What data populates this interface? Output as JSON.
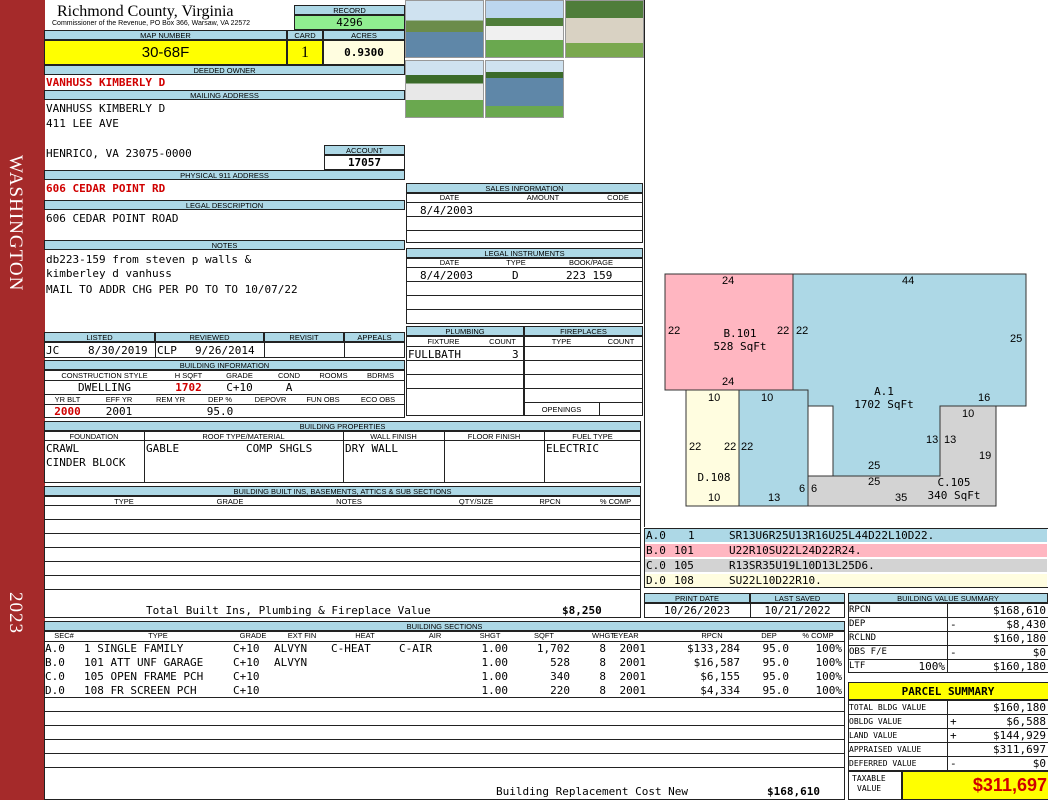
{
  "sidebar": {
    "district": "WASHINGTON",
    "year": "2023"
  },
  "header": {
    "county": "Richmond County, Virginia",
    "address_line": "Commissioner of the Revenue, PO Box 366, Warsaw, VA 22572",
    "record_label": "RECORD",
    "record": "4296",
    "map_number_label": "MAP NUMBER",
    "map_number": "30-68F",
    "card_label": "CARD",
    "card": "1",
    "acres_label": "ACRES",
    "acres": "0.9300"
  },
  "owner": {
    "deeded_owner_label": "DEEDED OWNER",
    "deeded_owner": "VANHUSS KIMBERLY D",
    "mailing_label": "MAILING ADDRESS",
    "mailing_line1": "VANHUSS KIMBERLY D",
    "mailing_line2": "411 LEE AVE",
    "mailing_line3": "HENRICO, VA 23075-0000",
    "account_label": "ACCOUNT",
    "account": "17057",
    "physical_label": "PHYSICAL 911 ADDRESS",
    "physical_address": "606 CEDAR POINT RD",
    "legal_label": "LEGAL DESCRIPTION",
    "legal_description": "606 CEDAR POINT ROAD",
    "notes_label": "NOTES",
    "notes_line1": "db223-159 from steven p walls &",
    "notes_line2": "kimberley d vanhuss",
    "notes_line3": "MAIL TO ADDR CHG PER PO TO TO 10/07/22"
  },
  "review": {
    "listed_label": "LISTED",
    "listed_by": "JC",
    "listed_date": "8/30/2019",
    "reviewed_label": "REVIEWED",
    "reviewed_by": "CLP",
    "reviewed_date": "9/26/2014",
    "revisit_label": "REVISIT",
    "appeals_label": "APPEALS"
  },
  "building_info": {
    "section_label": "BUILDING INFORMATION",
    "h_style": "CONSTRUCTION STYLE",
    "h_sqft": "H SQFT",
    "h_grade": "GRADE",
    "h_cond": "COND",
    "h_rooms": "ROOMS",
    "h_bdrms": "BDRMS",
    "style": "DWELLING",
    "sqft": "1702",
    "grade": "C+10",
    "cond": "A",
    "h_yrblt": "YR BLT",
    "h_effyr": "EFF YR",
    "h_remyr": "REM YR",
    "h_dep": "DEP %",
    "h_depovr": "DEPOVR",
    "h_funobs": "FUN OBS",
    "h_ecoobs": "ECO OBS",
    "yr_blt": "2000",
    "eff_yr": "2001",
    "dep": "95.0"
  },
  "sales": {
    "section_label": "SALES INFORMATION",
    "h_date": "DATE",
    "h_amount": "AMOUNT",
    "h_code": "CODE",
    "date": "8/4/2003"
  },
  "legal_instruments": {
    "section_label": "LEGAL INSTRUMENTS",
    "h_date": "DATE",
    "h_type": "TYPE",
    "h_bookpage": "BOOK/PAGE",
    "date": "8/4/2003",
    "type": "D",
    "bookpage": "223 159"
  },
  "plumbing": {
    "section_label": "PLUMBING",
    "h_fixture": "FIXTURE",
    "h_count": "COUNT",
    "fixture": "FULLBATH",
    "count": "3"
  },
  "fireplaces": {
    "section_label": "FIREPLACES",
    "h_type": "TYPE",
    "h_count": "COUNT",
    "openings_label": "OPENINGS"
  },
  "properties": {
    "section_label": "BUILDING PROPERTIES",
    "h_foundation": "FOUNDATION",
    "h_roof": "ROOF TYPE/MATERIAL",
    "h_wall": "WALL FINISH",
    "h_floor": "FLOOR FINISH",
    "h_fuel": "FUEL TYPE",
    "foundation1": "CRAWL",
    "foundation2": "CINDER BLOCK",
    "roof_type": "GABLE",
    "roof_material": "COMP SHGLS",
    "wall": "DRY WALL",
    "fuel": "ELECTRIC"
  },
  "builtins": {
    "section_label": "BUILDING BUILT INS, BASEMENTS, ATTICS & SUB SECTIONS",
    "h_type": "TYPE",
    "h_grade": "GRADE",
    "h_notes": "NOTES",
    "h_qty": "QTY/SIZE",
    "h_rpcn": "RPCN",
    "h_comp": "% COMP",
    "total_label": "Total Built Ins, Plumbing & Fireplace Value",
    "total_value": "$8,250"
  },
  "dates": {
    "print_label": "PRINT DATE",
    "print_date": "10/26/2023",
    "saved_label": "LAST SAVED",
    "saved_date": "10/21/2022"
  },
  "sections_table": {
    "section_label": "BUILDING SECTIONS",
    "headers": [
      "SEC#",
      "TYPE",
      "GRADE",
      "EXT FIN",
      "HEAT",
      "AIR",
      "SHGT",
      "SQFT",
      "WHGT",
      "EYEAR",
      "RPCN",
      "DEP",
      "% COMP"
    ],
    "rows": [
      [
        "A.0",
        "1 SINGLE FAMILY",
        "C+10",
        "ALVYN",
        "C-HEAT",
        "C-AIR",
        "1.00",
        "1,702",
        "8",
        "2001",
        "$133,284",
        "95.0",
        "100%"
      ],
      [
        "B.0",
        "101 ATT UNF GARAGE",
        "C+10",
        "ALVYN",
        "",
        "",
        "1.00",
        "528",
        "8",
        "2001",
        "$16,587",
        "95.0",
        "100%"
      ],
      [
        "C.0",
        "105 OPEN FRAME PCH",
        "C+10",
        "",
        "",
        "",
        "1.00",
        "340",
        "8",
        "2001",
        "$6,155",
        "95.0",
        "100%"
      ],
      [
        "D.0",
        "108 FR SCREEN PCH",
        "C+10",
        "",
        "",
        "",
        "1.00",
        "220",
        "8",
        "2001",
        "$4,334",
        "95.0",
        "100%"
      ]
    ],
    "replacement_label": "Building Replacement Cost New",
    "replacement_value": "$168,610"
  },
  "sketch": {
    "areas": [
      {
        "code": "B.101",
        "sqft": "528 SqFt"
      },
      {
        "code": "A.1",
        "sqft": "1702 SqFt"
      },
      {
        "code": "C.105",
        "sqft": "340 SqFt"
      },
      {
        "code": "D.108",
        "sqft": ""
      }
    ],
    "dims": [
      "24",
      "44",
      "22",
      "22",
      "22",
      "25",
      "24",
      "10",
      "10",
      "16",
      "10",
      "13",
      "13",
      "19",
      "22",
      "22",
      "22",
      "25",
      "25",
      "6",
      "6",
      "13",
      "35",
      "10"
    ],
    "legend": [
      {
        "sec": "A.0",
        "code": "1",
        "path": "SR13U6R25U13R16U25L44D22L10D22.",
        "color": "#add8e6"
      },
      {
        "sec": "B.0",
        "code": "101",
        "path": "U22R10SU22L24D22R24.",
        "color": "#ffb6c1"
      },
      {
        "sec": "C.0",
        "code": "105",
        "path": "R13SR35U19L10D13L25D6.",
        "color": "#d3d3d3"
      },
      {
        "sec": "D.0",
        "code": "108",
        "path": "SU22L10D22R10.",
        "color": "#fffde0"
      }
    ]
  },
  "value_summary": {
    "section_label": "BUILDING VALUE SUMMARY",
    "rpcn_label": "RPCN",
    "rpcn": "$168,610",
    "dep_label": "DEP",
    "dep_sign": "-",
    "dep": "$8,430",
    "rclnd_label": "RCLND",
    "rclnd": "$160,180",
    "obs_label": "OBS F/E",
    "obs_sign": "-",
    "obs": "$0",
    "ltf_label": "LTF",
    "ltf_pct": "100%",
    "ltf": "$160,180"
  },
  "parcel": {
    "title": "PARCEL SUMMARY",
    "total_bldg_label": "TOTAL BLDG VALUE",
    "total_bldg": "$160,180",
    "obldg_label": "OBLDG VALUE",
    "obldg_sign": "+",
    "obldg": "$6,588",
    "land_label": "LAND VALUE",
    "land_sign": "+",
    "land": "$144,929",
    "appraised_label": "APPRAISED VALUE",
    "appraised": "$311,697",
    "deferred_label": "DEFERRED VALUE",
    "deferred_sign": "-",
    "deferred": "$0",
    "taxable_label1": "TAXABLE",
    "taxable_label2": "VALUE",
    "taxable": "$311,697"
  },
  "colors": {
    "sidebar": "#a52a2a",
    "header_blue": "#add8e6",
    "highlight_yellow": "#ffff00",
    "record_green": "#90ee90",
    "owner_red": "#d00000"
  }
}
